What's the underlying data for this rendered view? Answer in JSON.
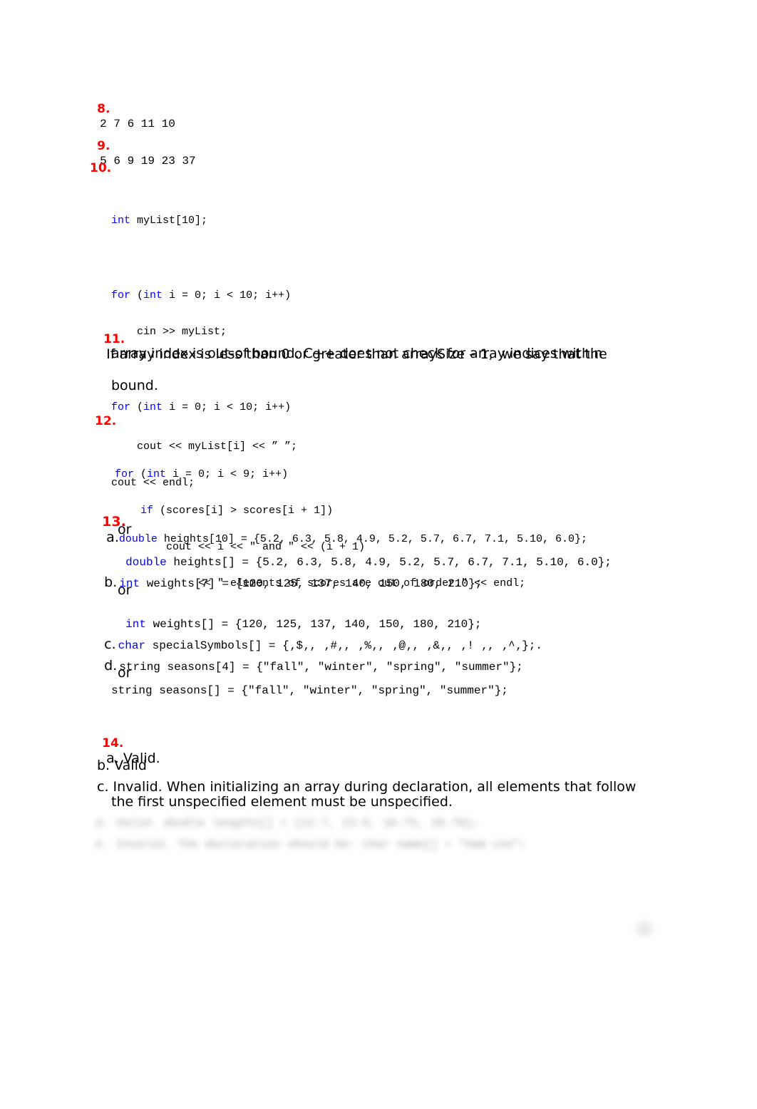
{
  "q8": {
    "num": "8.",
    "answer": "2 7 6 11 10"
  },
  "q9": {
    "num": "9.",
    "answer": "5 6 9 19 23 37"
  },
  "q10": {
    "num": "10.",
    "code": [
      {
        "kw": "int",
        "rest": " myList[10];"
      },
      {
        "kw": "for",
        "mid1": " (",
        "kw2": "int",
        "rest": " i = 0; i < 10; i++)"
      },
      {
        "rest": "    cin >> myList;"
      },
      {
        "kw": "for",
        "mid1": " (",
        "kw2": "int",
        "rest": " i = 0; i < 10; i++)"
      },
      {
        "rest": "    cout << myList[i] << ” ”;"
      },
      {
        "rest": "cout << endl;"
      }
    ]
  },
  "q11": {
    "num": "11.",
    "lines": [
      "If array index is less than 0 or greater than arraySize – 1,  we say that the",
      "array index is out-of bound. C++ does not check for array indices within",
      "bound."
    ]
  },
  "q12": {
    "num": "12.",
    "code": [
      {
        "kw": "for",
        "mid1": " (",
        "kw2": "int",
        "rest": " i = 0; i < 9; i++)"
      },
      {
        "indent": "    ",
        "kw": "if",
        "rest": " (scores[i] > scores[i + 1])"
      },
      {
        "rest": "        cout << i << \" and \" << (i + 1)"
      },
      {
        "rest": "             << \" elements of scores are out of order.\" << endl;"
      }
    ]
  },
  "q13": {
    "num": "13.",
    "a_label": "a.",
    "a_kw": "double",
    "a_code": " heights[10] = {5.2, 6.3, 5.8, 4.9, 5.2, 5.7, 6.7, 7.1, 5.10, 6.0};",
    "or": "or",
    "a2_kw": "double",
    "a2_code": " heights[] = {5.2, 6.3, 5.8, 4.9, 5.2, 5.7, 6.7, 7.1, 5.10, 6.0};",
    "b_label": "b.",
    "b_kw": "int",
    "b_code": " weights[7] = {120, 125, 137, 140, 150, 180, 210};",
    "b2_kw": "int",
    "b2_code": " weights[] = {120, 125, 137, 140, 150, 180, 210};",
    "c_label": "c.",
    "c_kw": "char",
    "c_code": " specialSymbols[] = {‚$‚, ‚#‚, ‚%‚, ‚@‚, ‚&‚, ‚! ‚, ‚^‚};.",
    "d_label": "d.",
    "d_code": "string seasons[4] = {\"fall\", \"winter\", \"spring\", \"summer\"};",
    "d2_code": "string seasons[] = {\"fall\", \"winter\", \"spring\", \"summer\"};"
  },
  "q14": {
    "num": "14.",
    "a": "a. Valid.",
    "b": "b. Valid",
    "c_line1": "c. Invalid. When initializing an array during declaration, all elements that follow",
    "c_line2": "the first unspecified element must be unspecified."
  },
  "blurred": {
    "line1": "d. Valid. double lengths[] = {12.7, 13.5, 18.75, 20.78};",
    "line2": "e. Invalid. The declaration should be: char name[] = \"Sam Lee\";"
  },
  "colors": {
    "number": "#ff0000",
    "keyword": "#0000ff",
    "text": "#000000"
  }
}
